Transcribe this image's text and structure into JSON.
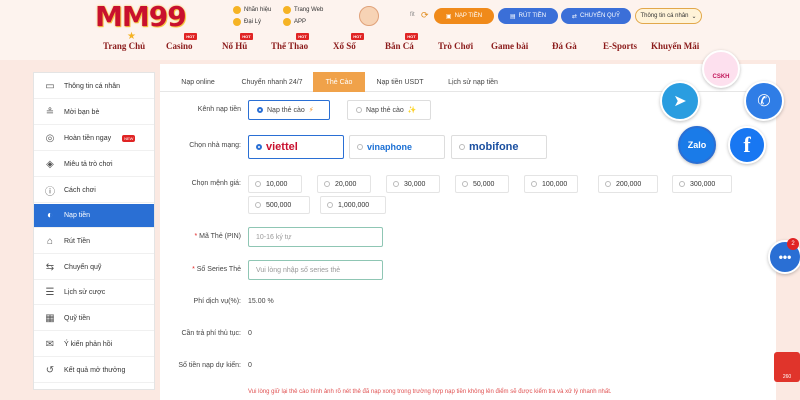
{
  "header": {
    "logo_text": "MM99",
    "top_links": [
      "Nhãn hiệu",
      "Trang Web",
      "Đại Lý",
      "APP"
    ],
    "user_id": "fit",
    "buttons": {
      "nap_tien": "NẠP TIỀN",
      "rut_tien": "RÚT TIỀN",
      "chuyen_quy": "CHUYỂN QUỸ",
      "account": "Thông tin cá nhân"
    }
  },
  "nav": {
    "items": [
      {
        "label": "Trang Chủ",
        "hot": false
      },
      {
        "label": "Casino",
        "hot": true
      },
      {
        "label": "Nổ Hũ",
        "hot": true
      },
      {
        "label": "Thể Thao",
        "hot": true
      },
      {
        "label": "Xổ Số",
        "hot": true
      },
      {
        "label": "Bắn Cá",
        "hot": true
      },
      {
        "label": "Trò Chơi",
        "hot": false
      },
      {
        "label": "Game bài",
        "hot": false
      },
      {
        "label": "Đá Gà",
        "hot": false
      },
      {
        "label": "E-Sports",
        "hot": false
      },
      {
        "label": "Khuyến Mãi",
        "hot": false
      }
    ],
    "hot_label": "HOT"
  },
  "sidebar": {
    "items": [
      {
        "label": "Thông tin cá nhân",
        "icon": "user-card-icon"
      },
      {
        "label": "Mời bạn bè",
        "icon": "invite-icon"
      },
      {
        "label": "Hoàn tiền ngay",
        "icon": "refund-icon",
        "badge": "NEW"
      },
      {
        "label": "Miêu tả trò chơi",
        "icon": "gamepad-icon"
      },
      {
        "label": "Cách chơi",
        "icon": "info-icon"
      },
      {
        "label": "Nạp tiền",
        "icon": "piggy-bank-icon",
        "active": true
      },
      {
        "label": "Rút Tiền",
        "icon": "bank-icon"
      },
      {
        "label": "Chuyển quỹ",
        "icon": "transfer-icon"
      },
      {
        "label": "Lịch sử cược",
        "icon": "history-icon"
      },
      {
        "label": "Quỹ tiền",
        "icon": "fund-icon"
      },
      {
        "label": "Ý kiến phản hồi",
        "icon": "feedback-icon"
      },
      {
        "label": "Kết quả mở thưởng",
        "icon": "results-icon"
      }
    ]
  },
  "tabs": [
    {
      "label": "Nạp online"
    },
    {
      "label": "Chuyển nhanh 24/7"
    },
    {
      "label": "Thẻ Cào",
      "active": true
    },
    {
      "label": "Nạp tiền USDT"
    },
    {
      "label": "Lịch sử nạp tiền"
    }
  ],
  "form": {
    "kenh_label": "Kênh nạp tiền",
    "kenh_options": [
      {
        "label": "Nạp thẻ cào",
        "mark": "⚡",
        "selected": true
      },
      {
        "label": "Nạp thẻ cào",
        "mark": "✨",
        "selected": false
      }
    ],
    "nha_mang_label": "Chọn nhà mạng:",
    "nha_mang": [
      {
        "name": "viettel",
        "color": "#c8102e",
        "selected": true
      },
      {
        "name": "vinaphone",
        "color": "#1a6fd4",
        "selected": false
      },
      {
        "name": "mobifone",
        "color": "#1a4fa0",
        "selected": false
      }
    ],
    "menh_gia_label": "Chọn mệnh giá:",
    "menh_gia": [
      "10,000",
      "20,000",
      "30,000",
      "50,000",
      "100,000",
      "200,000",
      "300,000",
      "500,000",
      "1,000,000"
    ],
    "ma_the_label": "Mã Thẻ (PIN)",
    "ma_the_placeholder": "10-16 ký tự",
    "seri_label": "Số Series Thẻ",
    "seri_placeholder": "Vui lòng nhập số series thẻ",
    "phi_label": "Phí dịch vụ(%):",
    "phi_value": "15.00 %",
    "tra_phi_label": "Cần trả phí thủ tục:",
    "tra_phi_value": "0",
    "du_kien_label": "Số tiền nạp dự kiến:",
    "du_kien_value": "0",
    "note": "Vui lòng giữ lại thẻ cào hình ảnh rõ nét thẻ đã nạp xong trong trường hợp nạp tiền không lên điểm sẽ được kiểm tra và xử lý nhanh nhất."
  },
  "floating": {
    "cskh": "CSKH",
    "zalo": "Zalo",
    "fb": "f",
    "chat_badge": "2",
    "gift_count": "260"
  }
}
